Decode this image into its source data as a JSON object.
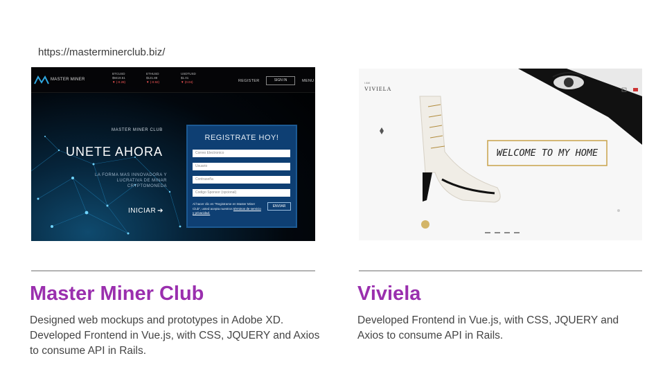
{
  "url": "https://masterminerclub.biz/",
  "accent_color": "#9a2fae",
  "master_miner_screenshot": {
    "brand": "MASTER MINER",
    "tickers": [
      {
        "pair": "BTCUSD",
        "price": "$9419.51",
        "change": "▼ (-0.28)"
      },
      {
        "pair": "ETHUSD",
        "price": "$121.88",
        "change": "▼ (-0.92)"
      },
      {
        "pair": "USDTUSD",
        "price": "$1.01",
        "change": "▼ (0.04)"
      }
    ],
    "nav": {
      "register": "REGISTER",
      "sign_in": "SIGN IN",
      "menu": "MENU"
    },
    "club_label": "MASTER MINER CLUB",
    "hero": "UNETE AHORA",
    "tagline": "LA FORMA MAS INNOVADORA Y LUCRATIVA DE MINAR CRYPTOMONEDA",
    "cta": "INICIAR",
    "cta_arrow": "➔",
    "form": {
      "title": "REGISTRATE HOY!",
      "fields": [
        "Correo Electronico",
        "Usuario",
        "Contraseña",
        "Codigo Sponsor (opcional)"
      ],
      "legal_text": "Al hacer clic en \"Registrarse en Master Miner Club\", usted acepta nuestros",
      "legal_link": "términos de servicio y privacidad.",
      "submit": "ENVIAR"
    }
  },
  "viviela_screenshot": {
    "logo_small": "I AM",
    "logo_name": "VIVIELA",
    "welcome": "WELCOME TO MY HOME"
  },
  "projects": [
    {
      "title": "Master Miner Club",
      "description": "Designed web mockups and prototypes in Adobe XD. Developed Frontend in Vue.js, with CSS, JQUERY and Axios to consume API in Rails."
    },
    {
      "title": "Viviela",
      "description": "Developed Frontend in Vue.js, with CSS, JQUERY and Axios to consume API in Rails."
    }
  ]
}
